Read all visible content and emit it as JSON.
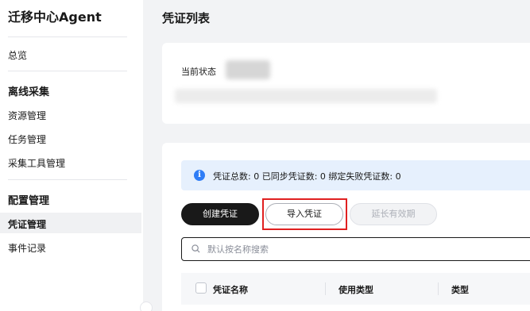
{
  "sidebar": {
    "app_title": "迁移中心Agent",
    "overview": "总览",
    "group_collect": "离线采集",
    "resource_mgmt": "资源管理",
    "task_mgmt": "任务管理",
    "collector_mgmt": "采集工具管理",
    "group_config": "配置管理",
    "credential_mgmt": "凭证管理",
    "event_log": "事件记录"
  },
  "main": {
    "page_title": "凭证列表",
    "status_label": "当前状态",
    "info": {
      "text": "凭证总数:  0    已同步凭证数:  0    绑定失败凭证数:  0"
    },
    "buttons": {
      "create": "创建凭证",
      "import": "导入凭证",
      "extend": "延长有效期"
    },
    "search": {
      "placeholder": "默认按名称搜索"
    },
    "table": {
      "columns": [
        "凭证名称",
        "使用类型",
        "类型"
      ]
    }
  },
  "colors": {
    "primary_button": "#191919",
    "info_bar": "#e6f0fd",
    "info_icon": "#2f7df6",
    "highlight": "#e02020",
    "page_bg": "#f2f3f5"
  },
  "icons": {
    "info": "info-icon",
    "search": "search-icon"
  }
}
